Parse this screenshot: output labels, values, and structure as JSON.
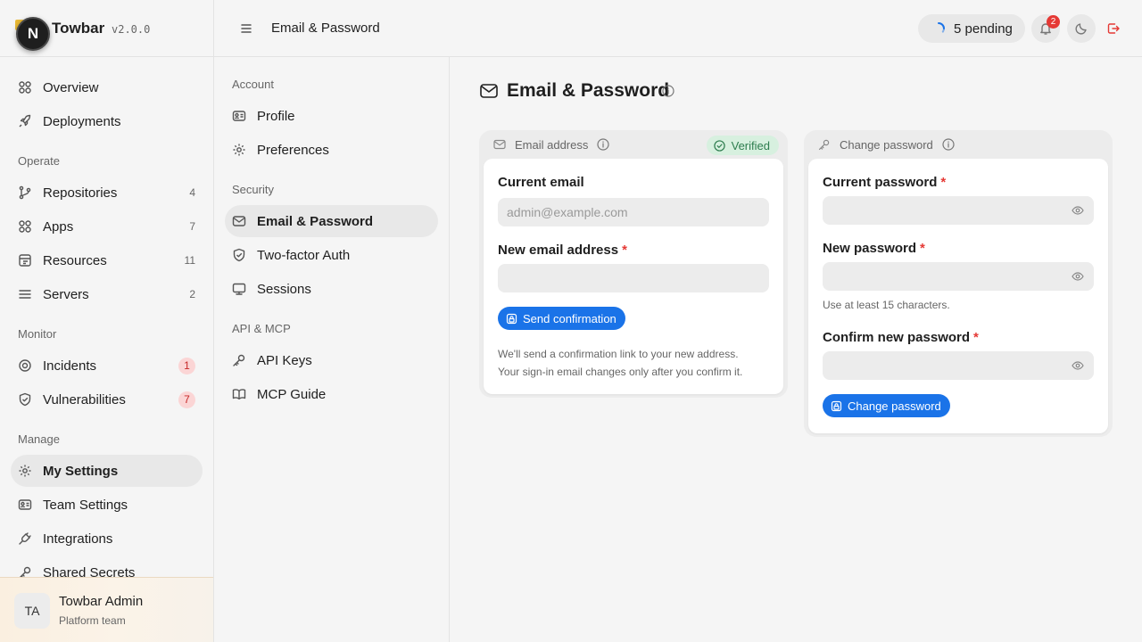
{
  "brand": {
    "logo_letter": "N",
    "name": "Towbar",
    "version": "v2.0.0"
  },
  "sidebar": {
    "top_items": [
      {
        "label": "Overview",
        "icon": "grid-icon"
      },
      {
        "label": "Deployments",
        "icon": "rocket-icon"
      }
    ],
    "groups": [
      {
        "label": "Operate",
        "items": [
          {
            "label": "Repositories",
            "count": "4",
            "icon": "git-branch-icon"
          },
          {
            "label": "Apps",
            "count": "7",
            "icon": "grid-icon"
          },
          {
            "label": "Resources",
            "count": "11",
            "icon": "database-icon"
          },
          {
            "label": "Servers",
            "count": "2",
            "icon": "server-icon"
          }
        ]
      },
      {
        "label": "Monitor",
        "items": [
          {
            "label": "Incidents",
            "badge": "1",
            "icon": "alert-circle-icon"
          },
          {
            "label": "Vulnerabilities",
            "badge": "7",
            "icon": "shield-icon"
          }
        ]
      },
      {
        "label": "Manage",
        "items": [
          {
            "label": "My Settings",
            "icon": "gear-icon",
            "active": true
          },
          {
            "label": "Team Settings",
            "icon": "id-card-icon"
          },
          {
            "label": "Integrations",
            "icon": "plug-icon"
          },
          {
            "label": "Shared Secrets",
            "icon": "key-icon"
          }
        ]
      }
    ],
    "user": {
      "initials": "TA",
      "name": "Towbar Admin",
      "team": "Platform team"
    }
  },
  "header": {
    "title": "Email & Password",
    "pending_label": "5 pending",
    "notification_count": "2"
  },
  "subnav": {
    "groups": [
      {
        "label": "Account",
        "items": [
          {
            "label": "Profile",
            "icon": "id-card-icon"
          },
          {
            "label": "Preferences",
            "icon": "gear-icon"
          }
        ]
      },
      {
        "label": "Security",
        "items": [
          {
            "label": "Email & Password",
            "icon": "mail-icon",
            "active": true
          },
          {
            "label": "Two-factor Auth",
            "icon": "shield-check-icon"
          },
          {
            "label": "Sessions",
            "icon": "monitor-icon"
          }
        ]
      },
      {
        "label": "API & MCP",
        "items": [
          {
            "label": "API Keys",
            "icon": "key-icon"
          },
          {
            "label": "MCP Guide",
            "icon": "book-icon"
          }
        ]
      }
    ]
  },
  "main": {
    "title": "Email & Password",
    "email_card": {
      "header": "Email address",
      "status": "Verified",
      "current_label": "Current email",
      "current_placeholder": "admin@example.com",
      "new_label": "New email address",
      "required_mark": "*",
      "button": "Send confirmation",
      "note_line1": "We'll send a confirmation link to your new address.",
      "note_line2": "Your sign-in email changes only after you confirm it."
    },
    "password_card": {
      "header": "Change password",
      "current_label": "Current password",
      "new_label": "New password",
      "hint": "Use at least 15 characters.",
      "confirm_label": "Confirm new password",
      "required_mark": "*",
      "button": "Change password"
    }
  },
  "colors": {
    "accent": "#1a73e8",
    "verified_bg": "#d7f0df",
    "verified_text": "#2e7d4f",
    "danger": "#e53935"
  }
}
